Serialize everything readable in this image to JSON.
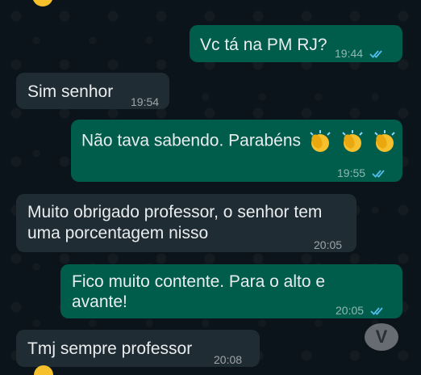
{
  "messages": [
    {
      "text": "Vc tá na PM RJ?",
      "time": "19:44",
      "direction": "outgoing",
      "read": true
    },
    {
      "text": "Sim senhor",
      "time": "19:54",
      "direction": "incoming"
    },
    {
      "text": "Não tava sabendo. Parabéns",
      "emoji": "clapping-hands x3",
      "time": "19:55",
      "direction": "outgoing",
      "read": true
    },
    {
      "text_line1": "Muito obrigado professor, o senhor tem",
      "text_line2": "uma porcentagem nisso",
      "time": "20:05",
      "direction": "incoming"
    },
    {
      "text_line1": "Fico muito contente. Para o alto e",
      "text_line2": "avante!",
      "time": "20:05",
      "direction": "outgoing",
      "read": true
    },
    {
      "text": "Tmj sempre professor",
      "time": "20:08",
      "direction": "incoming"
    }
  ],
  "colors": {
    "background": "#0b141a",
    "incoming_bubble": "#202c33",
    "outgoing_bubble": "#005c4b",
    "read_ticks": "#53bdeb"
  },
  "watermark": {
    "letter": "V"
  }
}
